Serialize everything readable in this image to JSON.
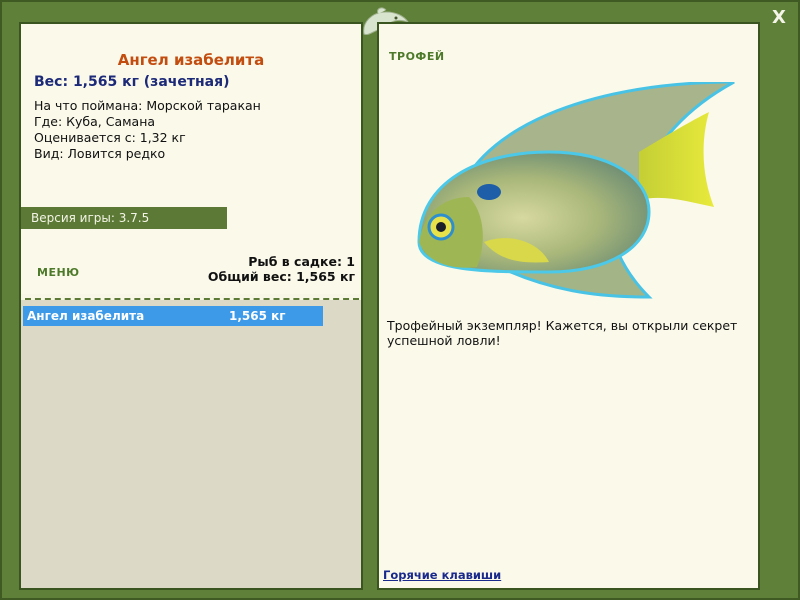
{
  "window": {
    "close_label": "X"
  },
  "fish": {
    "title": "Ангел изабелита",
    "weight": "Вес: 1,565 кг (зачетная)",
    "details": [
      "На что поймана: Морской таракан",
      "Где: Куба, Самана",
      "Оценивается с: 1,32 кг",
      "Вид: Ловится редко"
    ]
  },
  "version": "Версия игры: 3.7.5",
  "menu": {
    "label": "МЕНЮ"
  },
  "keepnet": {
    "count": "Рыб в садке: 1",
    "total": "Общий вес: 1,565 кг",
    "rows": [
      {
        "name": "Ангел изабелита",
        "weight": "1,565 кг"
      }
    ]
  },
  "trophy": {
    "label": "ТРОФЕЙ",
    "message": "Трофейный экземпляр! Кажется, вы открыли секрет успешной ловли!"
  },
  "hotkeys_label": "Горячие клавиши",
  "colors": {
    "frame": "#5f8038",
    "title": "#c24d0f",
    "weight": "#1c2a78",
    "selection": "#3d9ae8",
    "link": "#1a2a8c"
  },
  "icons": [
    "dolphin-icon",
    "close-icon",
    "angelfish-image"
  ]
}
